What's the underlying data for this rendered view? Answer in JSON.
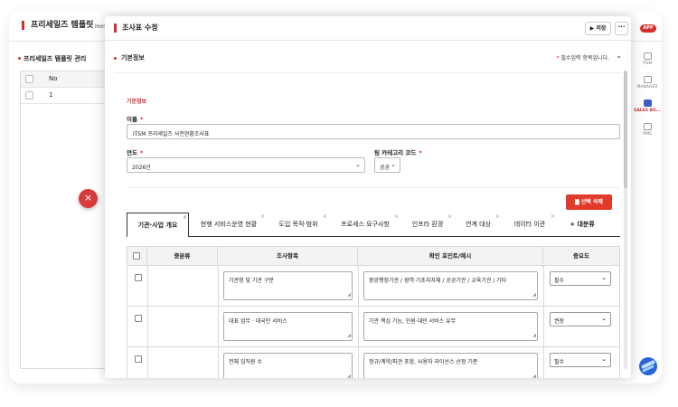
{
  "background": {
    "title": "프리세일즈 템플릿",
    "home": "Hom",
    "subtitle": "프리세일즈 템플릿 관리",
    "table_header_no": "No",
    "table_rows": [
      "1"
    ],
    "close_symbol": "×"
  },
  "right_sidebar": {
    "app_badge": "APP",
    "items": [
      {
        "label": "ITSM",
        "icon": "itsm-icon"
      },
      {
        "label": "MANAGER",
        "icon": "manager-icon"
      },
      {
        "label": "SALES BO...",
        "icon": "sales-board-icon",
        "active": true
      },
      {
        "label": "PMS",
        "icon": "pms-icon"
      }
    ]
  },
  "modal": {
    "title": "조사표 수정",
    "save_label": "▶ 저장",
    "more_label": "···",
    "section_title": "기본정보",
    "required_note": "필수입력 항목입니다.",
    "required_star": "*",
    "chevron": "⌄",
    "subsection": "기본정보",
    "name_label": "이름",
    "name_value": "ITSM 프리세일즈 사전현황조사표",
    "year_label": "연도",
    "year_value": "2026년",
    "category_label": "팀 카테고리 코드",
    "category_value": "공공",
    "delete_button": "선택 삭제",
    "delete_icon": "trash-icon"
  },
  "tabs": [
    {
      "label": "기관·사업 개요",
      "active": true
    },
    {
      "label": "현행 서비스운영 현황"
    },
    {
      "label": "도입 목적·범위"
    },
    {
      "label": "프로세스 요구사항"
    },
    {
      "label": "인프라 환경"
    },
    {
      "label": "연계 대상"
    },
    {
      "label": "데이터 이관"
    },
    {
      "label": "+ 대분류",
      "add": true
    }
  ],
  "tab_close": "×",
  "grid": {
    "headers": [
      "중분류",
      "조사항목",
      "확인 포인트/예시",
      "중요도"
    ],
    "rows": [
      {
        "item": "기관명 및 기관 구분",
        "point": "중앙행정기관 / 광역·기초지자체 / 공공기관 / 교육기관 / 기타",
        "importance": "필수"
      },
      {
        "item": "대표 업무 · 대국민 서비스",
        "point": "기관 핵심 기능, 민원·대민 서비스 유무",
        "importance": "권장"
      },
      {
        "item": "전체 임직원 수",
        "point": "정규/계약/파견 포함, 사용자 라이선스 산정 기준",
        "importance": "필수"
      }
    ]
  }
}
